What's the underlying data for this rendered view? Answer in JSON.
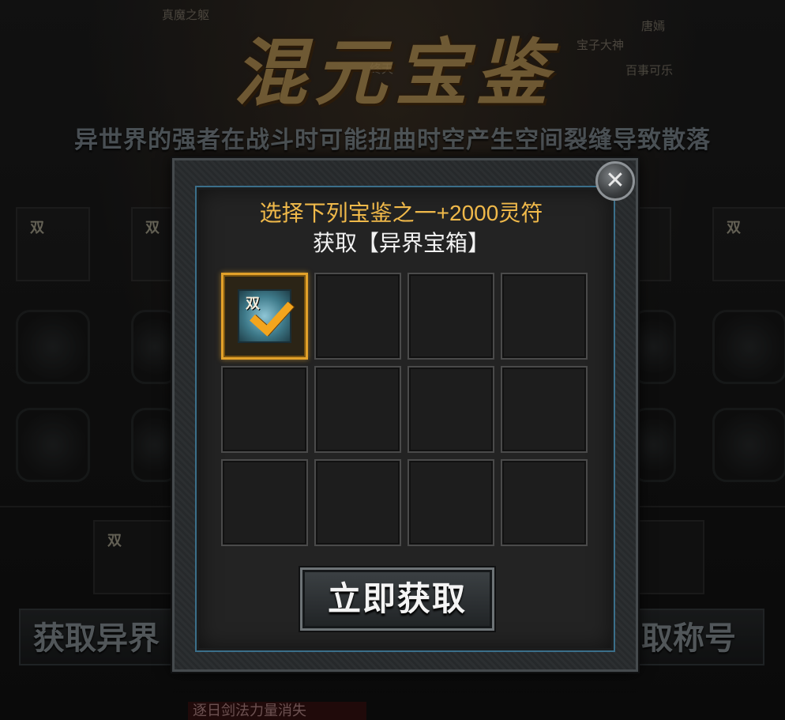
{
  "background": {
    "top_names": [
      "真魔之躯",
      "唐嫣",
      "宝子大神",
      "终天",
      "百事可乐"
    ],
    "event_title": "混元宝鉴",
    "description": "异世界的强者在战斗时可能扭曲时空产生空间裂缝导致散落",
    "slot_badge": "双",
    "left_button_label": "获取异界",
    "right_button_label": "取称号",
    "bottom_strip_text": "逐日剑法力量消失"
  },
  "dialog": {
    "prompt_line1": "选择下列宝鉴之一+2000灵符",
    "prompt_line2": "获取【异界宝箱】",
    "close_icon": "close-icon",
    "confirm_label": "立即获取",
    "grid": {
      "rows": 3,
      "cols": 4,
      "selected_index": 0,
      "first_item_badge": "双"
    }
  },
  "colors": {
    "prompt_highlight": "#f0b94a",
    "selected_border": "#e2a12a",
    "frame_accent": "#3b6f8a"
  }
}
